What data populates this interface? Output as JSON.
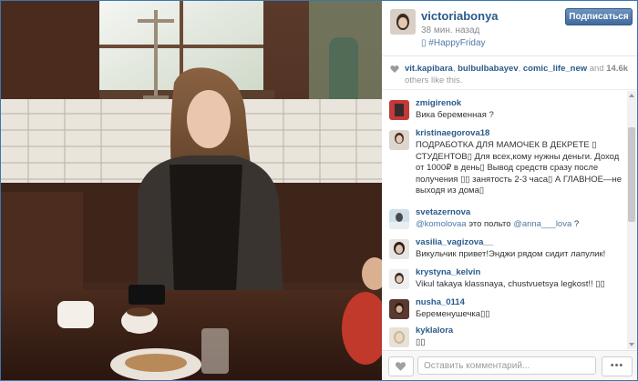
{
  "post": {
    "username": "victoriabonya",
    "time_ago": "38 мин. назад",
    "caption": "▯ #HappyFriday",
    "follow_label": "Подписаться"
  },
  "likes": {
    "users": [
      "vit.kapibara",
      "bulbulbabayev",
      "comic_life_new"
    ],
    "sep1": ", ",
    "sep2": ", ",
    "and_text": " and ",
    "count": "14.6k",
    "others_text": " others like this."
  },
  "comments": [
    {
      "user": "zmigirenok",
      "text": "Вика беременная ?"
    },
    {
      "user": "kristinaegorova18",
      "text": "ПОДРАБОТКА ДЛЯ МАМОЧЕК В ДЕКРЕТЕ ▯ СТУДЕНТОВ▯ Для всех,кому нужны деньги. Доход от 1000₽ в день▯ Вывод средств сразу после получения ▯▯ занятость 2-3 часа▯ А ГЛАВНОЕ—не выходя из дома▯"
    },
    {
      "user": "svetazernova",
      "mention1": "@komolovaa",
      "mid": " это польто ",
      "mention2": "@anna___lova",
      "end": " ?"
    },
    {
      "user": "vasilia_vagizova__",
      "text": "Викульчик привет!Энджи рядом сидит лапулик!"
    },
    {
      "user": "krystyna_kelvin",
      "text": "Vikul takaya klassnaya, chustvuetsya legkost!! ▯▯"
    },
    {
      "user": "nusha_0114",
      "text": "Беременушечка▯▯"
    },
    {
      "user": "kyklalora",
      "text": "▯▯"
    }
  ],
  "bottom": {
    "comment_placeholder": "Оставить комментарий...",
    "more_label": "•••"
  },
  "icons": {
    "heart": "heart-icon",
    "more": "more-icon"
  },
  "colors": {
    "username": "#2a5a8a",
    "link": "#4d7aa6",
    "follow_button": "#3f6a9b"
  }
}
